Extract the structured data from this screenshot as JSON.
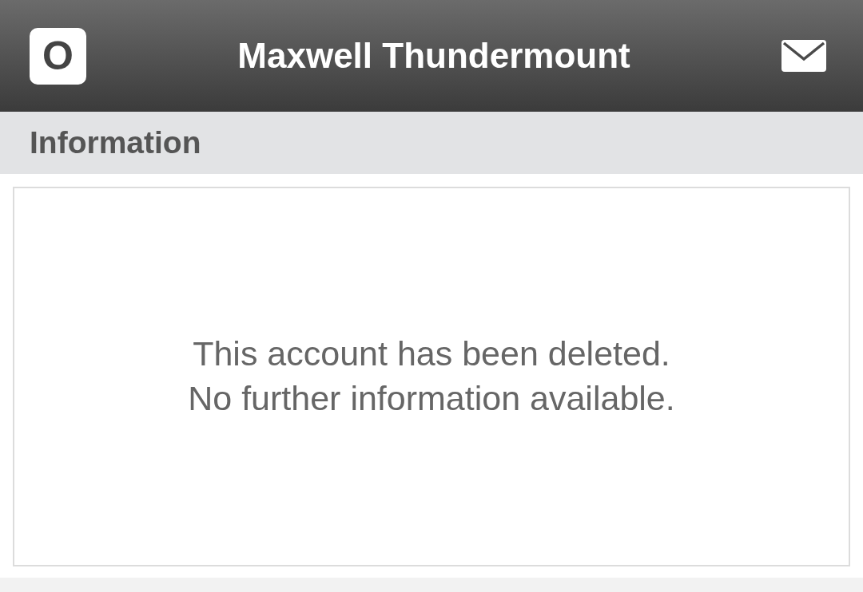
{
  "header": {
    "logo_letter": "O",
    "title": "Maxwell Thundermount"
  },
  "section": {
    "title": "Information"
  },
  "message": {
    "lines": [
      "This account has been deleted.",
      "No further information available."
    ]
  }
}
